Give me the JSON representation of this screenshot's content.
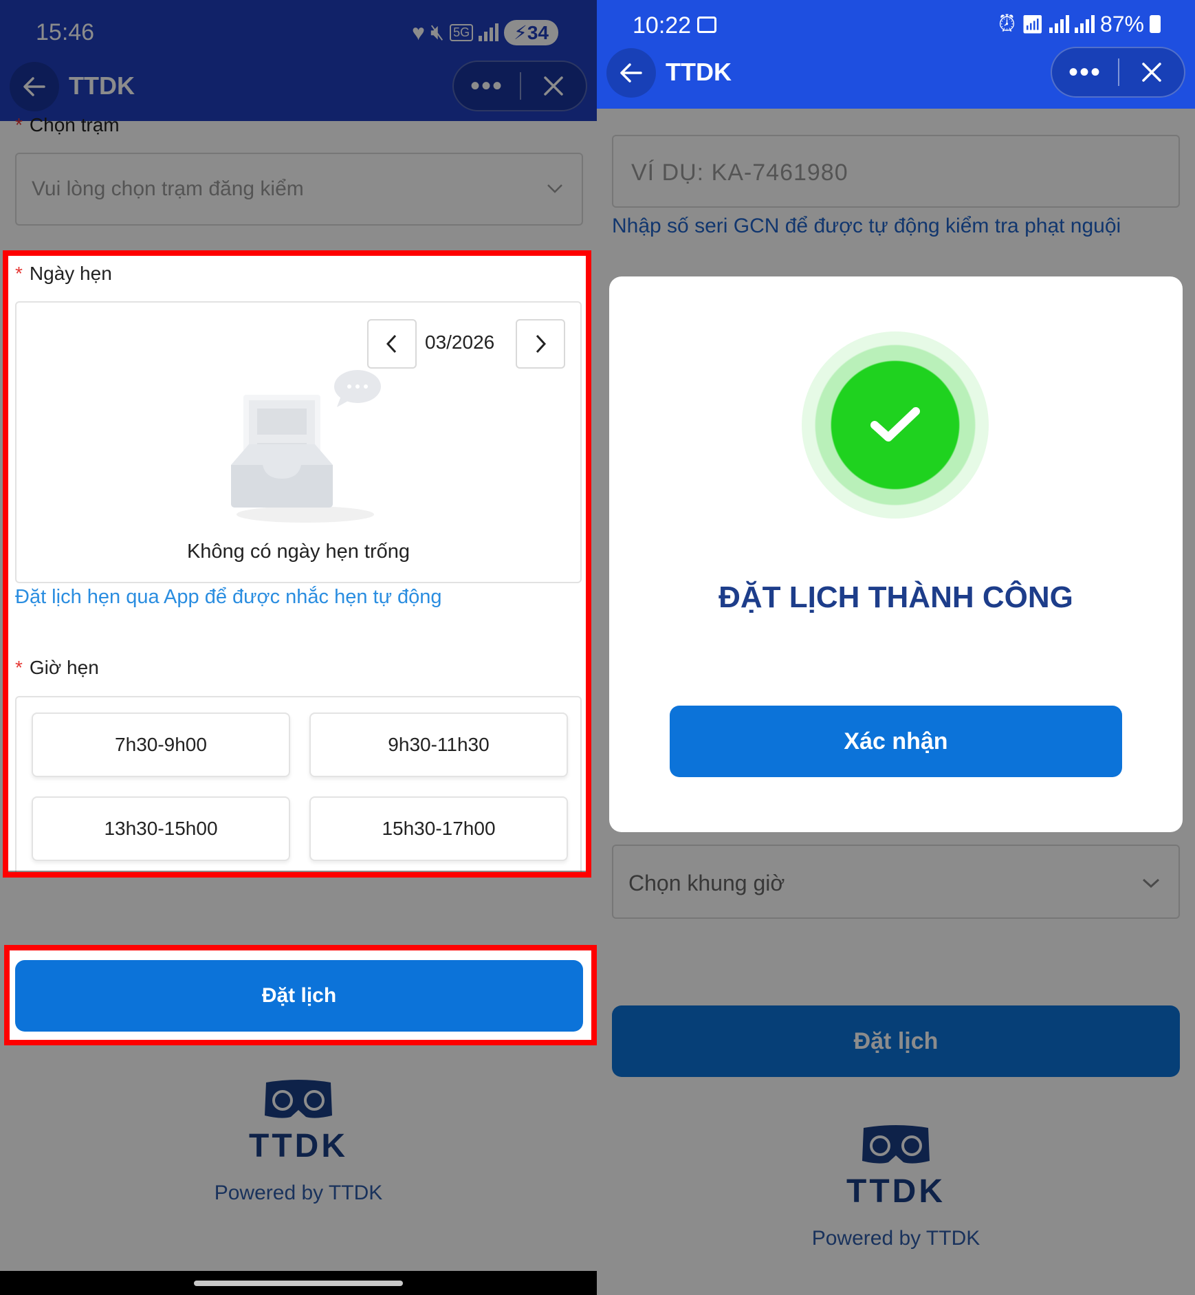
{
  "left": {
    "status": {
      "time": "15:46",
      "battery": "34",
      "network": "5G"
    },
    "header": {
      "title": "TTDK"
    },
    "station": {
      "label": "Chọn trạm",
      "placeholder": "Vui lòng chọn trạm đăng kiểm"
    },
    "date": {
      "label": "Ngày hẹn",
      "month": "03/2026",
      "empty_message": "Không có ngày hẹn trống",
      "app_link": "Đặt lịch hẹn qua App để được nhắc hẹn tự động"
    },
    "time": {
      "label": "Giờ hẹn",
      "slots": [
        "7h30-9h00",
        "9h30-11h30",
        "13h30-15h00",
        "15h30-17h00"
      ]
    },
    "submit_label": "Đặt lịch",
    "footer": {
      "logo_text": "TTDK",
      "powered": "Powered by TTDK"
    }
  },
  "right": {
    "status": {
      "time": "10:22",
      "battery": "87%"
    },
    "header": {
      "title": "TTDK"
    },
    "serial_input": {
      "placeholder": "VÍ DỤ: KA-7461980"
    },
    "serial_hint": "Nhập số seri GCN để được tự động kiểm tra phạt nguội",
    "modal": {
      "title": "ĐẶT LỊCH THÀNH CÔNG",
      "confirm_label": "Xác nhận"
    },
    "time_select": {
      "placeholder": "Chọn khung giờ"
    },
    "submit_label": "Đặt lịch",
    "footer": {
      "logo_text": "TTDK",
      "powered": "Powered by TTDK"
    }
  },
  "colors": {
    "header_left": "#1f3fbe",
    "header_right": "#1e4fe0",
    "primary_button": "#0c73d9",
    "highlight_frame": "#ff0000",
    "success_green": "#1fd21f",
    "brand_text": "#1a3f86",
    "link_blue": "#2a8de0"
  }
}
